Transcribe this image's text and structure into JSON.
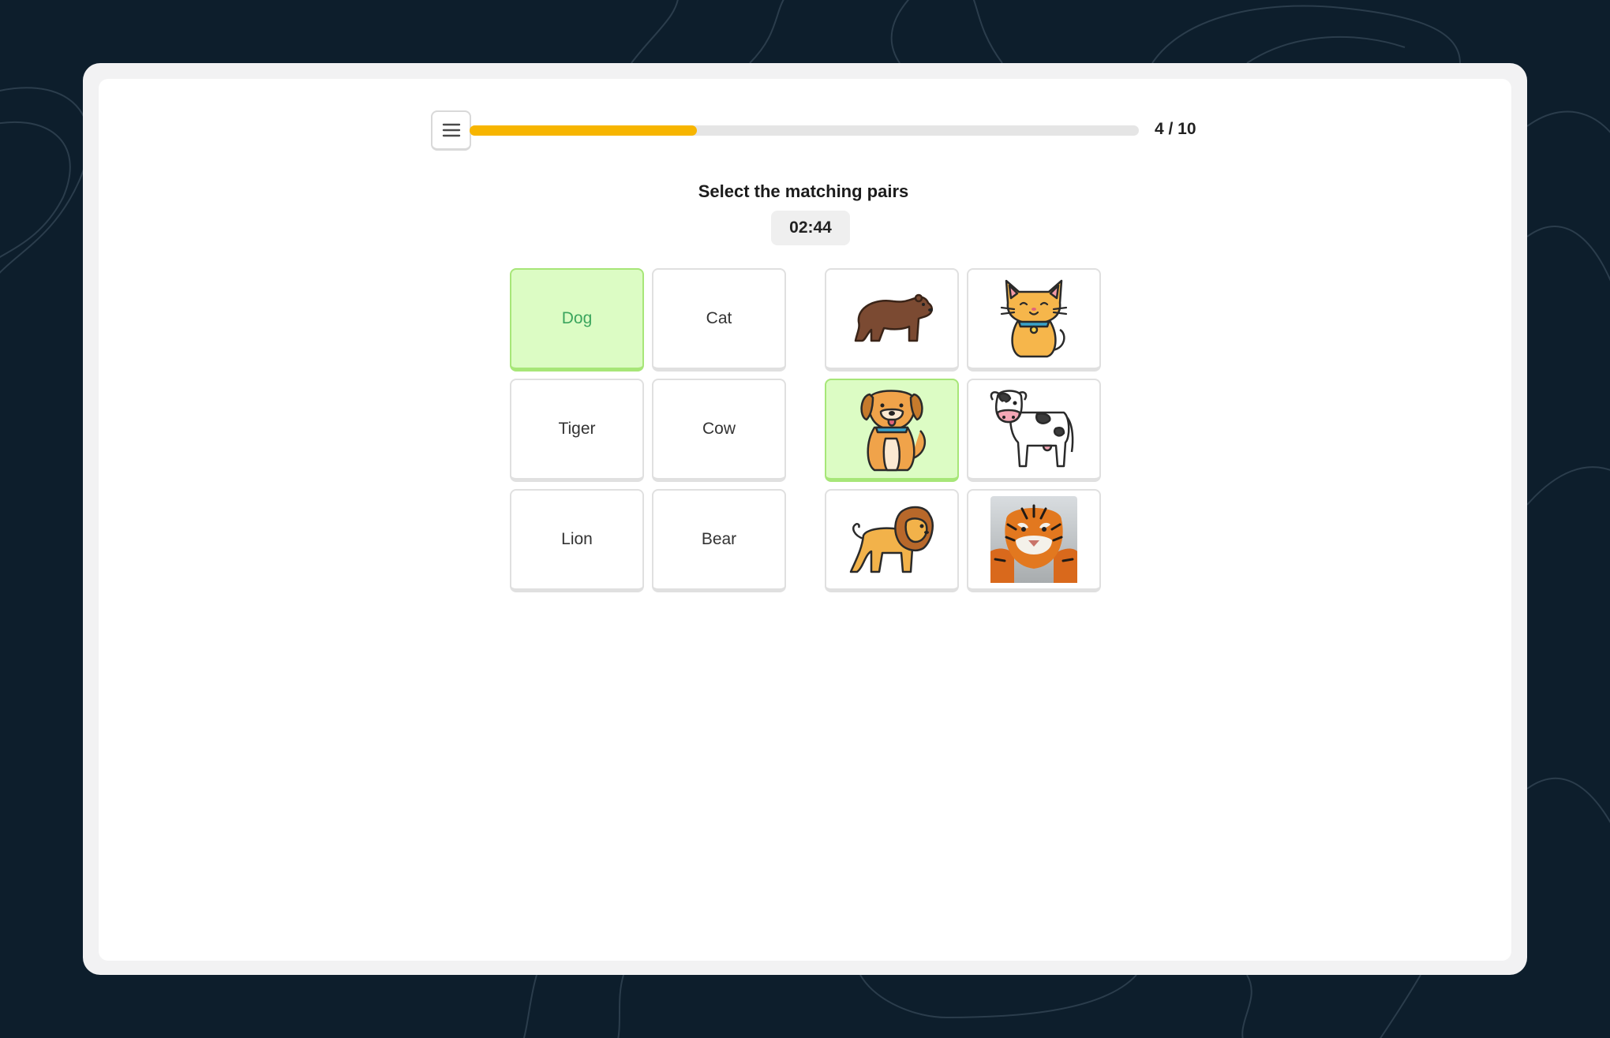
{
  "header": {
    "menu_icon": "hamburger-menu-icon",
    "progress": {
      "current": 4,
      "total": 10,
      "label": "4 / 10",
      "fill_fraction": 0.34,
      "fill_color": "#f7b500"
    }
  },
  "quiz": {
    "title": "Select the matching pairs",
    "timer": "02:44"
  },
  "word_tiles": [
    {
      "label": "Dog",
      "selected": true
    },
    {
      "label": "Cat",
      "selected": false
    },
    {
      "label": "Tiger",
      "selected": false
    },
    {
      "label": "Cow",
      "selected": false
    },
    {
      "label": "Lion",
      "selected": false
    },
    {
      "label": "Bear",
      "selected": false
    }
  ],
  "image_tiles": [
    {
      "icon": "bear-icon",
      "selected": false
    },
    {
      "icon": "cat-icon",
      "selected": false
    },
    {
      "icon": "dog-icon",
      "selected": true
    },
    {
      "icon": "cow-icon",
      "selected": false
    },
    {
      "icon": "lion-icon",
      "selected": false
    },
    {
      "icon": "tiger-photo",
      "selected": false
    }
  ],
  "colors": {
    "background": "#0d1e2c",
    "selected_fill": "#dcfcc4",
    "selected_border": "#a7e678",
    "selected_text": "#3ba55d",
    "progress": "#f7b500"
  }
}
